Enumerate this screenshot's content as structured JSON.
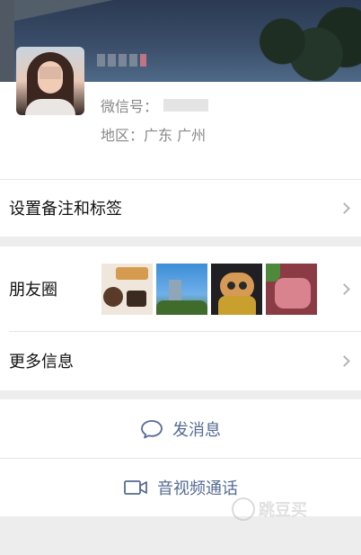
{
  "profile": {
    "wechat_id_label": "微信号：",
    "region_label": "地区：",
    "region_value": "广东 广州"
  },
  "menu": {
    "remark_tags": "设置备注和标签",
    "moments": "朋友圈",
    "more_info": "更多信息"
  },
  "actions": {
    "send_message": "发消息",
    "video_call": "音视频通话"
  },
  "watermark": {
    "text": "跳豆买"
  },
  "colors": {
    "link_blue": "#566b94",
    "background": "#ededed"
  }
}
